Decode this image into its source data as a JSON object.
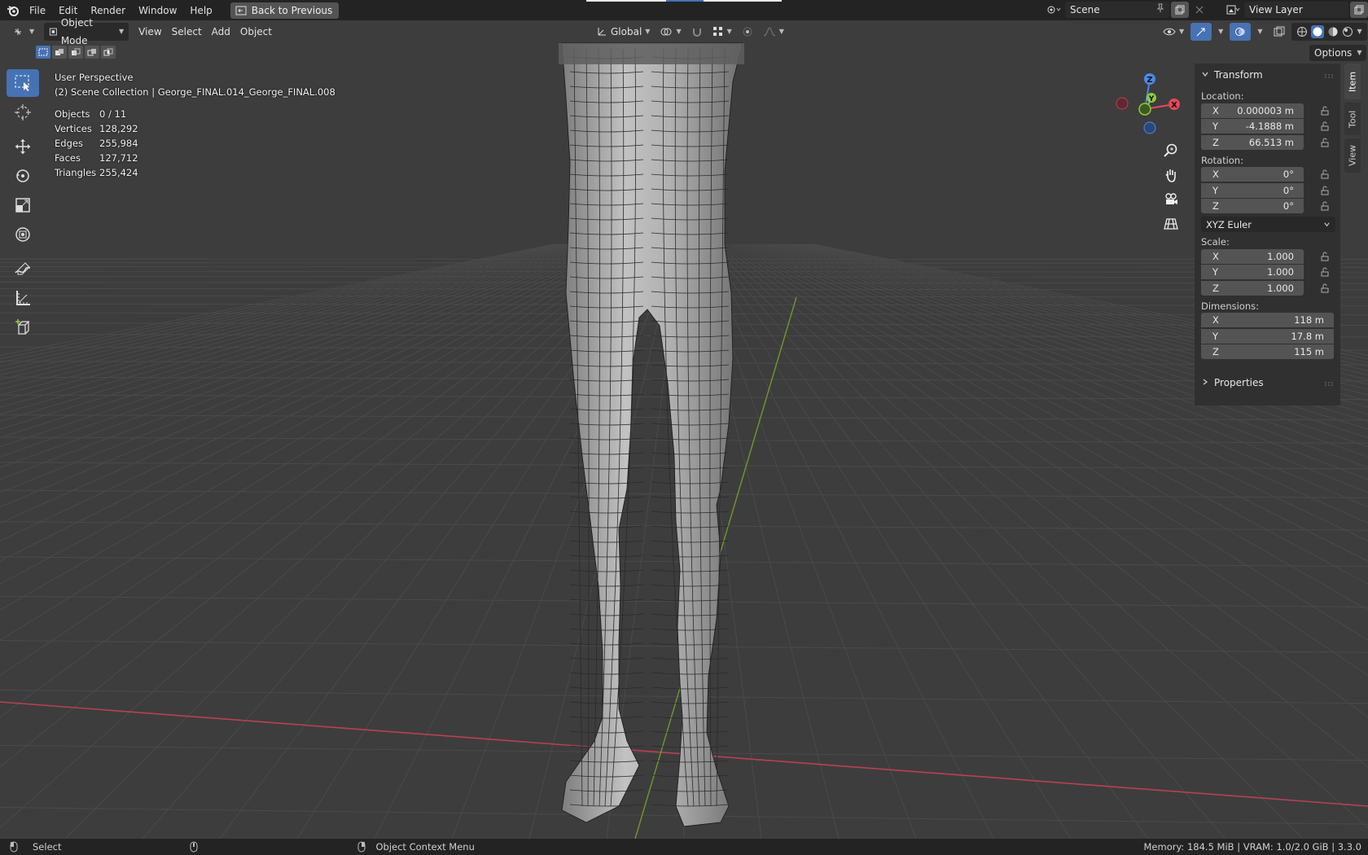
{
  "menubar": {
    "items": [
      "File",
      "Edit",
      "Render",
      "Window",
      "Help"
    ],
    "back_button": "Back to Previous",
    "scene": "Scene",
    "view_layer": "View Layer"
  },
  "viewport_header": {
    "mode": "Object Mode",
    "menus": [
      "View",
      "Select",
      "Add",
      "Object"
    ],
    "orientation": "Global",
    "options": "Options"
  },
  "overlay": {
    "perspective": "User Perspective",
    "collection": "(2) Scene Collection | George_FINAL.014_George_FINAL.008",
    "stats": [
      {
        "label": "Objects",
        "value": "0 / 11"
      },
      {
        "label": "Vertices",
        "value": "128,292"
      },
      {
        "label": "Edges",
        "value": "255,984"
      },
      {
        "label": "Faces",
        "value": "127,712"
      },
      {
        "label": "Triangles",
        "value": "255,424"
      }
    ]
  },
  "gizmo": {
    "z": "Z",
    "y": "Y",
    "x": "X"
  },
  "transform": {
    "title": "Transform",
    "location_label": "Location:",
    "location": [
      {
        "axis": "X",
        "value": "0.000003 m"
      },
      {
        "axis": "Y",
        "value": "-4.1888 m"
      },
      {
        "axis": "Z",
        "value": "66.513 m"
      }
    ],
    "rotation_label": "Rotation:",
    "rotation": [
      {
        "axis": "X",
        "value": "0°"
      },
      {
        "axis": "Y",
        "value": "0°"
      },
      {
        "axis": "Z",
        "value": "0°"
      }
    ],
    "rotation_mode": "XYZ Euler",
    "scale_label": "Scale:",
    "scale": [
      {
        "axis": "X",
        "value": "1.000"
      },
      {
        "axis": "Y",
        "value": "1.000"
      },
      {
        "axis": "Z",
        "value": "1.000"
      }
    ],
    "dimensions_label": "Dimensions:",
    "dimensions": [
      {
        "axis": "X",
        "value": "118 m"
      },
      {
        "axis": "Y",
        "value": "17.8 m"
      },
      {
        "axis": "Z",
        "value": "115 m"
      }
    ],
    "properties": "Properties"
  },
  "tabs": [
    "Item",
    "Tool",
    "View"
  ],
  "statusbar": {
    "left": "Select",
    "middle": "Object Context Menu",
    "right": "Memory: 184.5 MiB | VRAM: 1.0/2.0 GiB | 3.3.0"
  },
  "colors": {
    "accent": "#4772b3",
    "x_axis": "#e8475b",
    "y_axis": "#8ccb3a",
    "z_axis": "#4b8ae2"
  }
}
